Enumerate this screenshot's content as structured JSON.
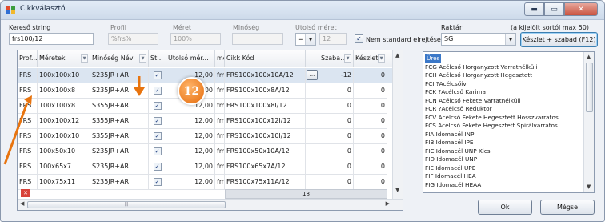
{
  "window": {
    "title": "Cikkválasztó",
    "controls": {
      "minimize": "▬",
      "maximize": "▭",
      "close": "✕"
    }
  },
  "filters": {
    "search_label": "Kereső string",
    "search_value": "frs100/12",
    "profile_label": "Profil",
    "profile_value": "%frs%",
    "size_label": "Méret",
    "size_value": "100%",
    "quality_label": "Minőség",
    "last_size_label": "Utolsó méret",
    "last_size_op": "=",
    "last_size_value": "12",
    "nonstandard_label": "Nem standard elrejtése",
    "nonstandard_checked": "✓",
    "warehouse_label": "Raktár",
    "warehouse_value": "SG",
    "hint": "(a kijelölt sortól max 50)",
    "stock_button": "Készlet + szabad (F12)"
  },
  "table": {
    "headers": [
      "Prof...",
      "Méretek",
      "Minőség Név",
      "St...",
      "Utolsó mér...",
      "me",
      "Cikk Kód",
      "",
      "Szaba...",
      "Készlet..."
    ],
    "rows": [
      [
        "FRS",
        "100x100x10",
        "S235JR+AR",
        "✓",
        "12,00",
        "fm",
        "FRS100x100x10A/12",
        "...",
        "-12",
        "0"
      ],
      [
        "FRS",
        "100x100x8",
        "S235JR+AR",
        "✓",
        "12,00",
        "fm",
        "FRS100x100x8A/12",
        "",
        "0",
        "0"
      ],
      [
        "FRS",
        "100x100x8",
        "S355JR+AR",
        "✓",
        "12,00",
        "fm",
        "FRS100x100x8I/12",
        "",
        "0",
        "0"
      ],
      [
        "FRS",
        "100x100x12",
        "S355JR+AR",
        "✓",
        "12,00",
        "fm",
        "FRS100x100x12I/12",
        "",
        "0",
        "0"
      ],
      [
        "FRS",
        "100x100x10",
        "S355JR+AR",
        "✓",
        "12,00",
        "fm",
        "FRS100x100x10I/12",
        "",
        "0",
        "0"
      ],
      [
        "FRS",
        "100x50x10",
        "S235JR+AR",
        "✓",
        "12,00",
        "fm",
        "FRS100x50x10A/12",
        "",
        "0",
        "0"
      ],
      [
        "FRS",
        "100x65x7",
        "S235JR+AR",
        "✓",
        "12,00",
        "fm",
        "FRS100x65x7A/12",
        "",
        "0",
        "0"
      ],
      [
        "FRS",
        "100x75x11",
        "S235JR+AR",
        "✓",
        "12,00",
        "fm",
        "FRS100x75x11A/12",
        "",
        "0",
        "0"
      ]
    ],
    "row_count": "18",
    "filter_clear": "✕"
  },
  "warehouse_list": [
    "Üres",
    "FCG Acélcső Horganyzott Varratnélküli",
    "FCH Acélcső Horganyzott Hegesztett",
    "FCI ?Acélcsőív",
    "FCK ?Acélcső Karima",
    "FCN Acélcső Fekete Varratnélküli",
    "FCR ?Acélcső Reduktor",
    "FCV Acélcső Fekete Hegesztett Hosszvarratos",
    "FCS Acélcső Fekete Hegesztett Spirálvarratos",
    "FIA Idomacél INP",
    "FIB Idomacél IPE",
    "FIC Idomacél UNP Kicsi",
    "FID Idomacél UNP",
    "FIE Idomacél UPE",
    "FIF Idomacél HEA",
    "FIG Idomacél HEAA"
  ],
  "buttons": {
    "ok": "Ok",
    "cancel": "Mégse"
  },
  "overlay": {
    "step_number": "12"
  },
  "colors": {
    "accent_orange": "#e8740f",
    "selection": "#3b78c8"
  }
}
